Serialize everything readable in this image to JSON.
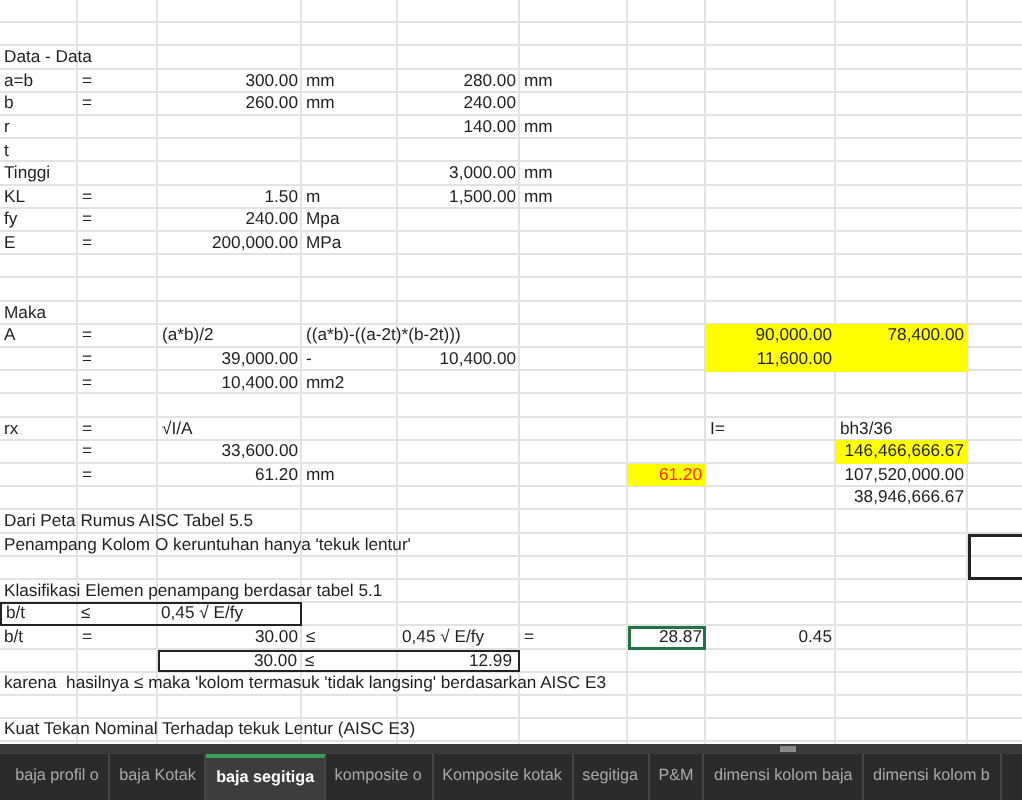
{
  "rows": [
    [
      null
    ],
    [
      null
    ],
    [
      {
        "text": "Data - Data",
        "kind": "text",
        "highlighted": false,
        "selected": false
      }
    ],
    [
      {
        "text": "a=b",
        "kind": "text",
        "highlighted": false,
        "selected": false
      },
      {
        "text": "=",
        "kind": "text",
        "highlighted": false,
        "selected": false
      },
      {
        "text": "300.00",
        "kind": "number",
        "highlighted": false,
        "selected": false
      },
      {
        "text": "mm",
        "kind": "text",
        "highlighted": false,
        "selected": false
      },
      {
        "text": "280.00",
        "kind": "number",
        "highlighted": false,
        "selected": false
      },
      {
        "text": "mm",
        "kind": "text",
        "highlighted": false,
        "selected": false
      }
    ],
    [
      {
        "text": "b",
        "kind": "text",
        "highlighted": false,
        "selected": false
      },
      {
        "text": "=",
        "kind": "text",
        "highlighted": false,
        "selected": false
      },
      {
        "text": "260.00",
        "kind": "number",
        "highlighted": false,
        "selected": false
      },
      {
        "text": "mm",
        "kind": "text",
        "highlighted": false,
        "selected": false
      },
      {
        "text": "240.00",
        "kind": "number",
        "highlighted": false,
        "selected": false
      }
    ],
    [
      {
        "text": "r",
        "kind": "text",
        "highlighted": false,
        "selected": false
      },
      null,
      null,
      null,
      {
        "text": "140.00",
        "kind": "number",
        "highlighted": false,
        "selected": false
      },
      {
        "text": "mm",
        "kind": "text",
        "highlighted": false,
        "selected": false
      }
    ],
    [
      {
        "text": "t",
        "kind": "text",
        "highlighted": false,
        "selected": false
      }
    ],
    [
      {
        "text": "Tinggi",
        "kind": "text",
        "highlighted": false,
        "selected": false
      },
      null,
      null,
      null,
      {
        "text": "3,000.00",
        "kind": "number",
        "highlighted": false,
        "selected": false
      },
      {
        "text": "mm",
        "kind": "text",
        "highlighted": false,
        "selected": false
      }
    ],
    [
      {
        "text": "KL",
        "kind": "text",
        "highlighted": false,
        "selected": false
      },
      {
        "text": "=",
        "kind": "text",
        "highlighted": false,
        "selected": false
      },
      {
        "text": "1.50",
        "kind": "number",
        "highlighted": false,
        "selected": false
      },
      {
        "text": "m",
        "kind": "text",
        "highlighted": false,
        "selected": false
      },
      {
        "text": "1,500.00",
        "kind": "number",
        "highlighted": false,
        "selected": false
      },
      {
        "text": "mm",
        "kind": "text",
        "highlighted": false,
        "selected": false
      }
    ],
    [
      {
        "text": "fy",
        "kind": "text",
        "highlighted": false,
        "selected": false
      },
      {
        "text": "=",
        "kind": "text",
        "highlighted": false,
        "selected": false
      },
      {
        "text": "240.00",
        "kind": "number",
        "highlighted": false,
        "selected": false
      },
      {
        "text": "Mpa",
        "kind": "text",
        "highlighted": false,
        "selected": false
      }
    ],
    [
      {
        "text": "E",
        "kind": "text",
        "highlighted": false,
        "selected": false
      },
      {
        "text": "=",
        "kind": "text",
        "highlighted": false,
        "selected": false
      },
      {
        "text": "200,000.00",
        "kind": "number",
        "highlighted": false,
        "selected": false
      },
      {
        "text": "MPa",
        "kind": "text",
        "highlighted": false,
        "selected": false
      }
    ],
    [
      null
    ],
    [
      null
    ],
    [
      {
        "text": "Maka",
        "kind": "text",
        "highlighted": false,
        "selected": false
      }
    ],
    [
      {
        "text": "A",
        "kind": "text",
        "highlighted": false,
        "selected": false
      },
      {
        "text": "=",
        "kind": "text",
        "highlighted": false,
        "selected": false
      },
      {
        "text": "(a*b)/2",
        "kind": "text",
        "highlighted": false,
        "selected": false
      },
      {
        "text": "((a*b)-((a-2t)*(b-2t)))",
        "kind": "text",
        "highlighted": false,
        "selected": false
      },
      null,
      null,
      null,
      {
        "text": "90,000.00",
        "kind": "number",
        "highlighted": true,
        "selected": false
      },
      {
        "text": "78,400.00",
        "kind": "number",
        "highlighted": true,
        "selected": false
      }
    ],
    [
      null,
      {
        "text": "=",
        "kind": "text",
        "highlighted": false,
        "selected": false
      },
      {
        "text": "39,000.00",
        "kind": "number",
        "highlighted": false,
        "selected": false
      },
      {
        "text": "-",
        "kind": "text",
        "highlighted": false,
        "selected": false
      },
      {
        "text": "10,400.00",
        "kind": "number",
        "highlighted": false,
        "selected": false
      },
      null,
      null,
      {
        "text": "11,600.00",
        "kind": "number",
        "highlighted": true,
        "selected": false
      },
      {
        "kind": "blank",
        "highlighted": true,
        "selected": false
      }
    ],
    [
      null,
      {
        "text": "=",
        "kind": "text",
        "highlighted": false,
        "selected": false
      },
      {
        "text": "10,400.00",
        "kind": "number",
        "highlighted": false,
        "selected": false
      },
      {
        "text": "mm2",
        "kind": "text",
        "highlighted": false,
        "selected": false
      }
    ],
    [
      null
    ],
    [
      {
        "text": "rx",
        "kind": "text",
        "highlighted": false,
        "selected": false
      },
      {
        "text": "=",
        "kind": "text",
        "highlighted": false,
        "selected": false
      },
      {
        "text": "√I/A",
        "kind": "text",
        "highlighted": false,
        "selected": false
      },
      null,
      null,
      null,
      null,
      {
        "text": "I=",
        "kind": "text",
        "highlighted": false,
        "selected": false
      },
      {
        "text": "bh3/36",
        "kind": "text",
        "highlighted": false,
        "selected": false
      }
    ],
    [
      null,
      {
        "text": "=",
        "kind": "text",
        "highlighted": false,
        "selected": false
      },
      {
        "text": "33,600.00",
        "kind": "number",
        "highlighted": false,
        "selected": false
      },
      null,
      null,
      null,
      null,
      null,
      {
        "text": "146,466,666.67",
        "kind": "number",
        "highlighted": true,
        "selected": false
      }
    ],
    [
      null,
      {
        "text": "=",
        "kind": "text",
        "highlighted": false,
        "selected": false
      },
      {
        "text": "61.20",
        "kind": "number",
        "highlighted": false,
        "selected": false
      },
      {
        "text": "mm",
        "kind": "text",
        "highlighted": false,
        "selected": false
      },
      null,
      null,
      {
        "text": "61.20",
        "kind": "alert",
        "highlighted": true,
        "selected": false
      },
      null,
      {
        "text": "107,520,000.00",
        "kind": "number",
        "highlighted": false,
        "selected": false
      }
    ],
    [
      null,
      null,
      null,
      null,
      null,
      null,
      null,
      null,
      {
        "text": "38,946,666.67",
        "kind": "number",
        "highlighted": false,
        "selected": false
      }
    ],
    [
      {
        "text": "Dari Peta Rumus AISC Tabel 5.5",
        "kind": "text",
        "highlighted": false,
        "selected": false
      }
    ],
    [
      {
        "text": "Penampang Kolom O keruntuhan hanya 'tekuk lentur'",
        "kind": "text",
        "highlighted": false,
        "selected": false
      },
      null,
      null,
      null,
      null,
      null,
      null,
      null,
      null,
      {
        "kind": "frame-top",
        "highlighted": false,
        "selected": false
      }
    ],
    [
      null,
      null,
      null,
      null,
      null,
      null,
      null,
      null,
      null,
      {
        "kind": "frame-bottom",
        "highlighted": false,
        "selected": false
      }
    ],
    [
      {
        "text": "Klasifikasi Elemen penampang berdasar tabel 5.1",
        "kind": "text",
        "highlighted": false,
        "selected": false
      }
    ],
    [
      {
        "kind": "box",
        "cells": [
          {
            "text": "b/t",
            "kind": "text",
            "highlighted": false,
            "selected": false
          },
          {
            "text": "≤",
            "kind": "text",
            "highlighted": false,
            "selected": false
          },
          {
            "text": "0,45 √ E/fy",
            "kind": "text",
            "highlighted": false,
            "selected": false
          }
        ]
      }
    ],
    [
      {
        "text": "b/t",
        "kind": "text",
        "highlighted": false,
        "selected": false
      },
      {
        "text": "=",
        "kind": "text",
        "highlighted": false,
        "selected": false
      },
      {
        "text": "30.00",
        "kind": "number",
        "highlighted": false,
        "selected": false
      },
      {
        "text": "≤",
        "kind": "text",
        "highlighted": false,
        "selected": false
      },
      {
        "text": "0,45 √ E/fy",
        "kind": "text",
        "highlighted": false,
        "selected": false
      },
      {
        "text": "=",
        "kind": "text",
        "highlighted": false,
        "selected": false
      },
      {
        "text": "28.87",
        "kind": "number",
        "highlighted": false,
        "selected": true
      },
      {
        "text": "0.45",
        "kind": "number",
        "highlighted": false,
        "selected": false
      }
    ],
    [
      null,
      null,
      {
        "kind": "box",
        "cells": [
          {
            "text": "30.00",
            "kind": "number",
            "highlighted": false,
            "selected": false
          },
          {
            "text": "≤",
            "kind": "text",
            "highlighted": false,
            "selected": false
          },
          {
            "text": "12.99",
            "kind": "number",
            "highlighted": false,
            "selected": false
          }
        ]
      }
    ],
    [
      {
        "text": "karena  hasilnya ≤ maka 'kolom termasuk 'tidak langsing' berdasarkan AISC E3",
        "kind": "text",
        "highlighted": false,
        "selected": false
      }
    ],
    [
      null
    ],
    [
      {
        "text": "Kuat Tekan Nominal Terhadap tekuk Lentur (AISC E3)",
        "kind": "text",
        "highlighted": false,
        "selected": false
      }
    ]
  ],
  "tabs": [
    {
      "label": "baja profil o",
      "selected": false
    },
    {
      "label": "baja Kotak",
      "selected": false
    },
    {
      "label": "baja segitiga",
      "selected": true
    },
    {
      "label": "komposite o",
      "selected": false
    },
    {
      "label": "Komposite kotak",
      "selected": false
    },
    {
      "label": "segitiga",
      "selected": false
    },
    {
      "label": "P&M",
      "selected": false
    },
    {
      "label": "dimensi kolom baja",
      "selected": false
    },
    {
      "label": "dimensi kolom b",
      "selected": false
    }
  ]
}
